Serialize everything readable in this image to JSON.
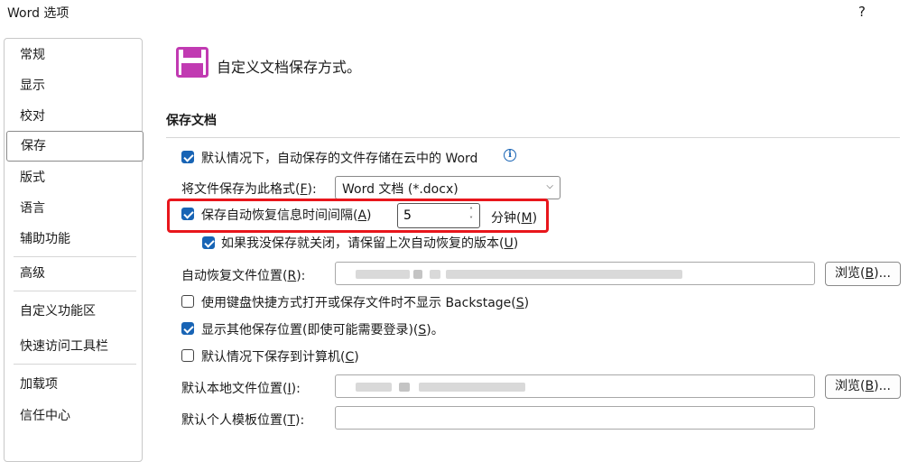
{
  "window": {
    "title": "Word 选项",
    "help_label": "?"
  },
  "sidebar": {
    "items": [
      {
        "label": "常规"
      },
      {
        "label": "显示"
      },
      {
        "label": "校对"
      },
      {
        "label": "保存",
        "selected": true
      },
      {
        "label": "版式"
      },
      {
        "label": "语言"
      },
      {
        "label": "辅助功能"
      },
      {
        "label": "高级"
      },
      {
        "label": "自定义功能区"
      },
      {
        "label": "快速访问工具栏"
      },
      {
        "label": "加载项"
      },
      {
        "label": "信任中心"
      }
    ]
  },
  "main": {
    "heading": "自定义文档保存方式。",
    "heading_icon": "floppy-disk-icon",
    "section_title": "保存文档",
    "autosave_cloud": {
      "label": "默认情况下，自动保存的文件存储在云中的 Word",
      "checked": true,
      "info_icon": "ⓘ"
    },
    "file_format": {
      "label_pre": "将文件保存为此格式(",
      "label_key": "F",
      "label_post": "):",
      "selected": "Word 文档 (*.docx)",
      "arrow": "⌄"
    },
    "autorecover_interval": {
      "label_pre": "保存自动恢复信息时间间隔(",
      "label_key": "A",
      "label_post": ")",
      "checked": true,
      "value": "5",
      "unit_pre": "分钟(",
      "unit_key": "M",
      "unit_post": ")",
      "up_arrow": "˄",
      "down_arrow": "˅"
    },
    "keep_last_version": {
      "label_pre": "如果我没保存就关闭，请保留上次自动恢复的版本(",
      "label_key": "U",
      "label_post": ")",
      "checked": true
    },
    "autorecover_location": {
      "label_pre": "自动恢复文件位置(",
      "label_key": "R",
      "label_post": "):",
      "value": ""
    },
    "browse_button_1": {
      "label_pre": "浏览(",
      "label_key": "B",
      "label_post": ")..."
    },
    "no_backstage": {
      "label_pre": "使用键盘快捷方式打开或保存文件时不显示 Backstage(",
      "label_key": "S",
      "label_post": ")",
      "checked": false
    },
    "show_additional_places": {
      "label_pre": "显示其他保存位置(即使可能需要登录)(",
      "label_key": "S",
      "label_post": ")。",
      "checked": true
    },
    "save_to_computer": {
      "label_pre": "默认情况下保存到计算机(",
      "label_key": "C",
      "label_post": ")",
      "checked": false
    },
    "default_local_location": {
      "label_pre": "默认本地文件位置(",
      "label_key": "I",
      "label_post": "):",
      "value": ""
    },
    "browse_button_2": {
      "label_pre": "浏览(",
      "label_key": "B",
      "label_post": ")..."
    },
    "personal_templates_location": {
      "label_pre": "默认个人模板位置(",
      "label_key": "T",
      "label_post": "):",
      "value": ""
    }
  },
  "colors": {
    "accent": "#1864b5",
    "highlight_border": "#e8161c",
    "floppy": "#c13ab2"
  }
}
